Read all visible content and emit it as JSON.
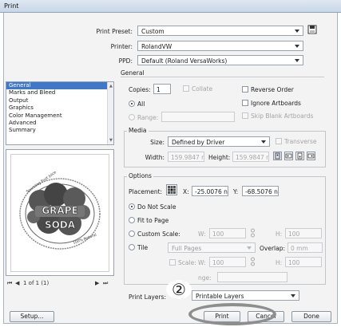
{
  "window": {
    "title": "Print"
  },
  "top": {
    "preset_label": "Print Preset:",
    "preset_value": "Custom",
    "printer_label": "Printer:",
    "printer_value": "RolandVW",
    "ppd_label": "PPD:",
    "ppd_value": "Default (Roland VersaWorks)"
  },
  "sidebar": {
    "items": [
      {
        "label": "General",
        "selected": true
      },
      {
        "label": "Marks and Bleed"
      },
      {
        "label": "Output"
      },
      {
        "label": "Graphics"
      },
      {
        "label": "Color Management"
      },
      {
        "label": "Advanced"
      },
      {
        "label": "Summary"
      }
    ]
  },
  "general": {
    "section_label": "General",
    "copies_label": "Copies:",
    "copies_value": "1",
    "collate_label": "Collate",
    "reverse_order_label": "Reverse Order",
    "all_label": "All",
    "ignore_artboards_label": "Ignore Artboards",
    "range_label": "Range:",
    "skip_blank_label": "Skip Blank Artboards"
  },
  "media": {
    "title": "Media",
    "size_label": "Size:",
    "size_value": "Defined by Driver",
    "transverse_label": "Transverse",
    "width_label": "Width:",
    "width_value": "159.9847 r",
    "height_label": "Height:",
    "height_value": "159.9847 r"
  },
  "options": {
    "title": "Options",
    "placement_label": "Placement:",
    "x_label": "X:",
    "x_value": "-25.0076 n",
    "y_label": "Y:",
    "y_value": "-68.5076 n",
    "do_not_scale_label": "Do Not Scale",
    "fit_to_page_label": "Fit to Page",
    "custom_scale_label": "Custom Scale:",
    "custom_w_label": "W:",
    "custom_w_value": "100",
    "custom_h_label": "H:",
    "custom_h_value": "100",
    "tile_label": "Tile",
    "tile_value": "Full Pages",
    "overlap_label": "Overlap:",
    "overlap_value": "0 mm",
    "scale_label": "Scale:",
    "scale_w_label": "W:",
    "scale_w_value": "100",
    "scale_h_label": "H:",
    "scale_h_value": "100",
    "tile_range_label": "nge:"
  },
  "preview": {
    "page_label": "1 of 1 (1)",
    "artwork_top_text": "GRAPE",
    "artwork_bottom_text": "SODA",
    "ring_text_left": "Sparkling Fruit Juice",
    "ring_text_right": "100% Natural"
  },
  "layers": {
    "label": "Print Layers:",
    "value": "Printable Layers"
  },
  "annotation": {
    "marker": "②"
  },
  "buttons": {
    "setup": "Setup...",
    "print": "Print",
    "cancel": "Cancel",
    "done": "Done"
  },
  "colors": {
    "accent": "#3f78c8",
    "annotation_gray": "#8e8e8e"
  }
}
